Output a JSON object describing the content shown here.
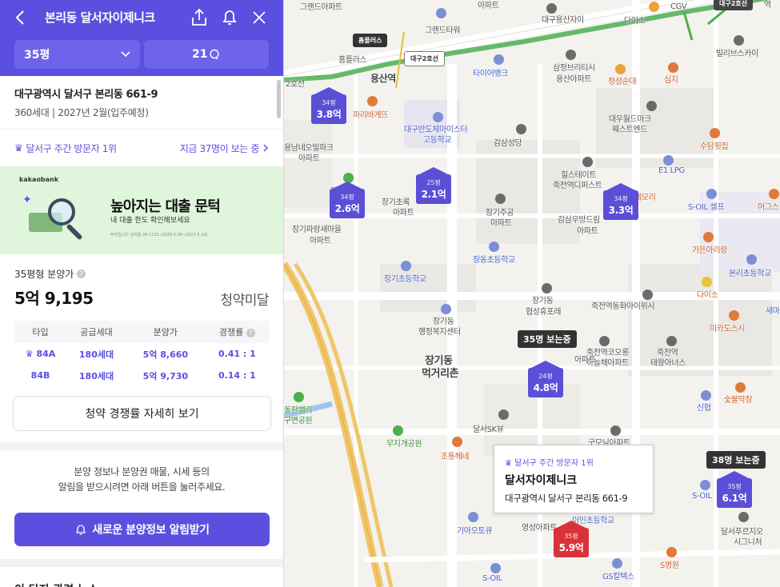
{
  "header": {
    "title": "본리동 달서자이제니크",
    "size_select": "35평",
    "comment_count": "21"
  },
  "complex": {
    "address": "대구광역시 달서구 본리동 661-9",
    "summary": "360세대 | 2027년 2월(입주예정)"
  },
  "rank": {
    "label": "달서구 주간 방문자 1위",
    "viewers": "지금 37명이 보는 중"
  },
  "banner": {
    "brand": "kakaobank",
    "title": "높아지는 대출 문턱",
    "subtitle": "내 대출 한도 확인해보세요",
    "fineprint": "무엇입니다 심의필 26-1131 (2026.5.30~2027.5.29)"
  },
  "price": {
    "label": "35평형 분양가",
    "value": "5억 9,195",
    "status": "청약미달"
  },
  "table": {
    "headers": [
      "타입",
      "공급세대",
      "분양가",
      "경쟁률"
    ],
    "rows": [
      {
        "type": "84A",
        "units": "180세대",
        "price": "5억 8,660",
        "ratio": "0.41 : 1"
      },
      {
        "type": "84B",
        "units": "180세대",
        "price": "5억 9,730",
        "ratio": "0.14 : 1"
      }
    ]
  },
  "detail_button": "청약 경쟁률 자세히 보기",
  "notice": {
    "line1": "분양 정보나 분양권 매물, 시세 등의",
    "line2": "알림을 받으시려면 아래 버튼을 눌러주세요."
  },
  "alarm_button": "새로운 분양정보 알림받기",
  "news_title": "이 단지 관련 뉴스",
  "map": {
    "labels": {
      "grande_apt": "그랜드아파트",
      "apt_top": "아파트",
      "daegu_yongsan": "대구용산자이",
      "daiso_top": "다이소",
      "cgv": "CGV",
      "line2_badge": "대구2호선",
      "ex_top": "역",
      "grande_tower": "그랜드타워",
      "homeplus_lbl": "홈플러스",
      "homeplus_sign": "홈플러스",
      "line2_sign": "대구2호선",
      "yongsan_st": "용산역",
      "station2_lbl": "2호선",
      "timee_bank": "타이어뱅크",
      "samjeong1": "삼정브리티시",
      "samjeong2": "용산아파트",
      "jeongsung": "정성순대",
      "simji": "심지",
      "billy": "빌리브스카이",
      "paris": "파리바게뜨",
      "daegu_banpo1": "대구반도체마이스터",
      "daegu_banpo2": "고등학교",
      "gamsam": "감삼성당",
      "daewoo1": "대우월드마크",
      "daewoo2": "웨스트엔드",
      "suduk": "수담횟집",
      "yongnam1": "용남네오빌파크",
      "yongnam2": "아파트",
      "hill1": "힐스테이트",
      "hill2": "죽전역디퍼스트",
      "e1lpg": "E1 LPG",
      "paris2": "파리",
      "janggi_apt1": "장기초록",
      "janggi_apt2": "아파트",
      "jangji1": "장기주공",
      "jangji2": "아파트",
      "gamsam_ap1": "감삼우방드림",
      "gamsam_ap2": "아파트",
      "nemori": "네모리",
      "soil1": "S-OIL 셀프",
      "eogeus": "어그스",
      "janggipar1": "장기파랑새마을",
      "janggipar2": "아파트",
      "gadenaria": "가든아리랑",
      "jangdong_el": "장동초등학교",
      "bonri_el": "본리초등학교",
      "janggi_el": "장기초등학교",
      "daiso2": "다이소",
      "janggi_hyup1": "장기동",
      "janggi_hyup2": "협성휴포레",
      "jukjeon_hwa": "죽전역동화아이위시",
      "semi": "새마",
      "janggi_center1": "장기동",
      "janggi_center2": "행정복지센터",
      "mikado": "미카도스시",
      "jukjeon_koro1": "죽전역코오롱",
      "jukjeon_koro2": "하늘채아파트",
      "jukjeon_ta1": "죽전역",
      "jukjeon_ta2": "태왕아너스",
      "meokgori1": "장기동",
      "meokgori2": "먹거리촌",
      "apt_ul": "아파트",
      "sulbit": "숯불막장",
      "sinhyup": "신협",
      "gupeom1": "돌판밸리",
      "gupeom2": "구변공원",
      "dalseo_skview": "달서SK뷰",
      "mumug": "무지개공원",
      "gumoni": "굿모닝아파트",
      "johune": "조통헤네",
      "soil2": "S-OIL",
      "giat": "기아오토큐",
      "yeongsan": "영성아파트",
      "bonri_el2": "이인초등학교",
      "dalseo_fu1": "달서푸르지오",
      "dalseo_fu2": "시그니처",
      "sbyeong": "S병원",
      "soil3": "S-OIL",
      "gscaltex": "GS칼텍스"
    },
    "markers": [
      {
        "size": "34평",
        "amount": "3.8억"
      },
      {
        "size": "34평",
        "amount": "2.6억"
      },
      {
        "size": "25평",
        "amount": "2.1억"
      },
      {
        "size": "34평",
        "amount": "3.3억"
      },
      {
        "size": "24평",
        "amount": "4.8억"
      },
      {
        "size": "35평",
        "amount": "6.1억"
      },
      {
        "size": "35평",
        "amount": "5.9억"
      }
    ],
    "tags": [
      "35명 보는중",
      "38명 보는중"
    ],
    "popup": {
      "rank": "달서구 주간 방문자 1위",
      "name": "달서자이제니크",
      "address": "대구광역시 달서구 본리동 661-9"
    }
  }
}
